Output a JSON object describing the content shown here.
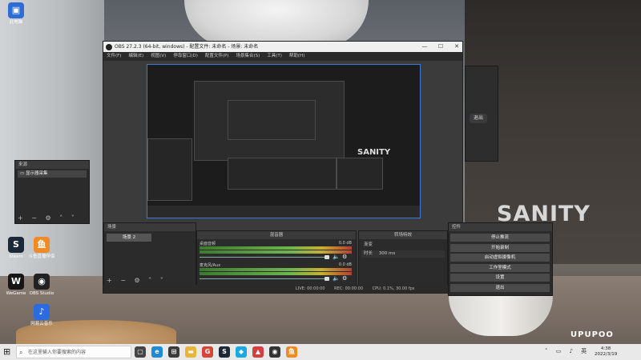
{
  "desktop": {
    "icons": [
      {
        "label": "此电脑",
        "color": "#2f6dd6",
        "glyph": "▣"
      },
      {
        "label": "Steam",
        "color": "#1b2838",
        "glyph": "S"
      },
      {
        "label": "WeGame",
        "color": "#161616",
        "glyph": "W"
      },
      {
        "label": "Steam",
        "color": "#1b2838",
        "glyph": "S"
      },
      {
        "label": "斗鱼直播伴侣",
        "color": "#f08a24",
        "glyph": "鱼"
      },
      {
        "label": "OBS Studio",
        "color": "#222222",
        "glyph": "◉"
      },
      {
        "label": "斗鱼直播伴侣",
        "color": "#f08a24",
        "glyph": "鱼"
      },
      {
        "label": "网易云音乐",
        "color": "#2d6be0",
        "glyph": "♪"
      }
    ],
    "overlay_text": "SANITY",
    "watermark": "UPUPOO"
  },
  "obs": {
    "title": "OBS 27.2.3 (64-bit, windows) - 配置文件: 未命名 - 场景: 未命名",
    "menu": [
      "文件(F)",
      "编辑(E)",
      "视图(V)",
      "停靠窗口(D)",
      "配置文件(P)",
      "场景集合(S)",
      "工具(T)",
      "帮助(H)"
    ],
    "window_buttons": [
      "—",
      "☐",
      "✕"
    ],
    "scenes_title": "场景",
    "selected_scene": "场景 2",
    "scenes_footer": "+ − ⚙ ˄ ˅",
    "sources_title": "来源",
    "source_item": "显示器采集",
    "sources_footer": "+ − ⚙ ˄ ˅",
    "mixer_title": "混音器",
    "mixer_tracks": [
      {
        "name": "桌面音频",
        "db": "0.0 dB"
      },
      {
        "name": "麦克风/Aux",
        "db": "0.0 dB"
      }
    ],
    "transitions_title": "转场特效",
    "transition_name": "渐变",
    "duration_label": "时长",
    "duration_value": "300 ms",
    "controls_title": "控件",
    "controls": [
      "停止推流",
      "开始录制",
      "启动虚拟摄像机",
      "工作室模式",
      "设置",
      "退出"
    ],
    "status": [
      "LIVE: 00:00:00",
      "REC: 00:00:00",
      "CPU: 0.1%, 30.00 fps"
    ]
  },
  "side_app": {
    "exit_label": "退出"
  },
  "taskbar": {
    "search_placeholder": "在这里输入你要搜索的内容",
    "time": "4:38",
    "date": "2022/3/19",
    "pinned": [
      {
        "name": "task-view-icon",
        "color": "#444444",
        "glyph": "▢"
      },
      {
        "name": "edge-icon",
        "color": "#1f8ad6",
        "glyph": "e"
      },
      {
        "name": "store-icon",
        "color": "#3a3a3a",
        "glyph": "⊞"
      },
      {
        "name": "explorer-icon",
        "color": "#e7b53a",
        "glyph": "▬"
      },
      {
        "name": "google-icon",
        "color": "#d44638",
        "glyph": "G"
      },
      {
        "name": "steam-icon",
        "color": "#1b2838",
        "glyph": "S"
      },
      {
        "name": "app-icon",
        "color": "#1aa8e0",
        "glyph": "◆"
      },
      {
        "name": "app2-icon",
        "color": "#d63f3f",
        "glyph": "▲"
      },
      {
        "name": "obs-icon",
        "color": "#333333",
        "glyph": "◉"
      },
      {
        "name": "douyu-icon",
        "color": "#f08a24",
        "glyph": "鱼"
      }
    ]
  }
}
